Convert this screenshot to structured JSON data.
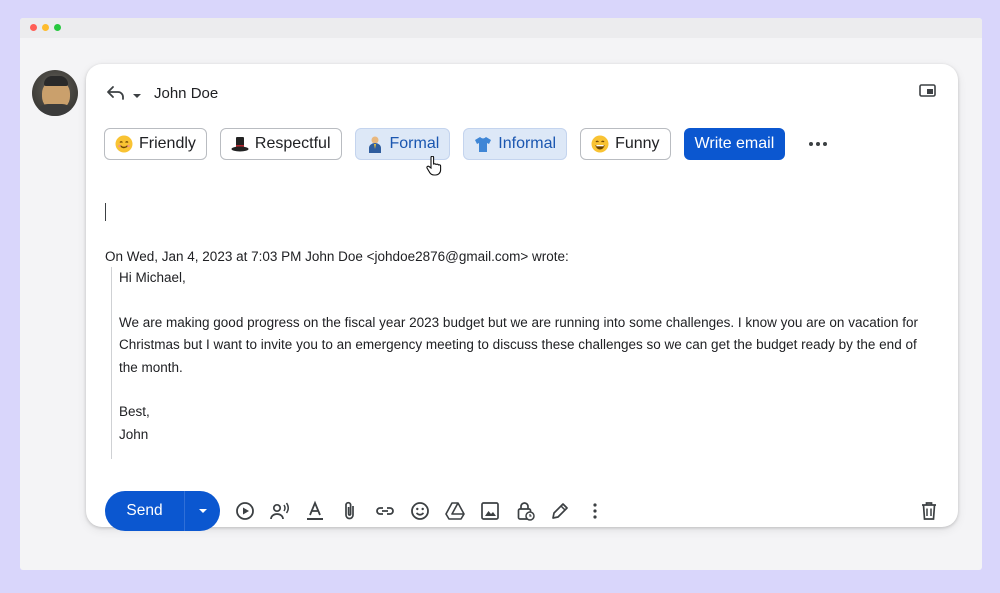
{
  "window": {
    "controls": [
      "close",
      "minimize",
      "zoom"
    ]
  },
  "header": {
    "recipient": "John Doe",
    "icons": [
      "reply-icon",
      "chevron-down-icon",
      "popout-icon"
    ]
  },
  "tones": [
    {
      "label": "Friendly",
      "emoji": "smiling-face-icon",
      "selected": false
    },
    {
      "label": "Respectful",
      "emoji": "top-hat-icon",
      "selected": false
    },
    {
      "label": "Formal",
      "emoji": "business-person-icon",
      "selected": true
    },
    {
      "label": "Informal",
      "emoji": "t-shirt-icon",
      "selected": true
    },
    {
      "label": "Funny",
      "emoji": "grinning-face-icon",
      "selected": false
    }
  ],
  "write_email_label": "Write email",
  "quote": {
    "header": "On Wed, Jan 4, 2023 at 7:03 PM John Doe <johdoe2876@gmail.com> wrote:",
    "greeting": "Hi Michael,",
    "body": "We are making good progress on the fiscal year 2023 budget but we are running into some challenges. I know you are on vacation for Christmas but I want to invite you to an emergency meeting to discuss these challenges so we can get the budget ready by the end of the month.",
    "signoff": "Best,",
    "signature": "John"
  },
  "toolbar": {
    "send_label": "Send",
    "icons": [
      "play-circle-icon",
      "voice-icon",
      "text-format-icon",
      "attach-icon",
      "link-icon",
      "emoji-icon",
      "drive-icon",
      "image-icon",
      "lock-clock-icon",
      "pen-icon",
      "more-vert-icon",
      "trash-icon"
    ]
  },
  "colors": {
    "accent": "#0b57d0",
    "selected_chip": "#dde8f7",
    "background": "#d9d6fb"
  }
}
